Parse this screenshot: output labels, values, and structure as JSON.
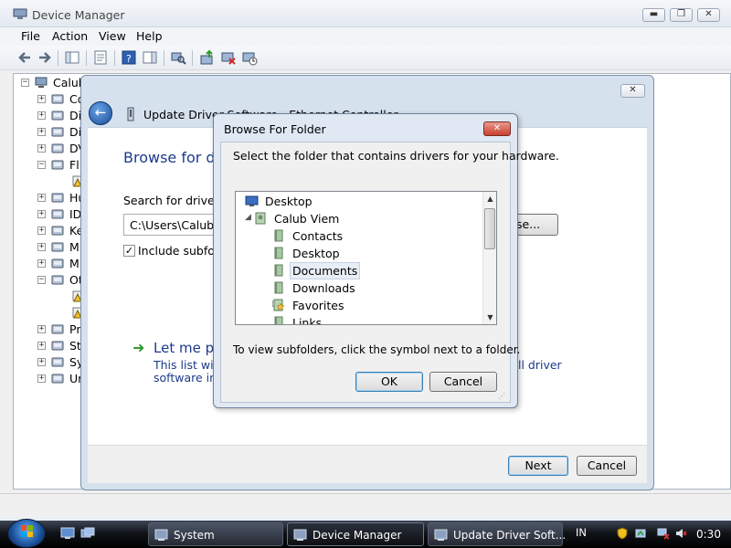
{
  "device_manager": {
    "title": "Device Manager",
    "menu": [
      "File",
      "Action",
      "View",
      "Help"
    ],
    "caption_buttons": {
      "minimize": "▬",
      "maximize": "❐",
      "close": "✕"
    },
    "tree": {
      "root": "Calub",
      "items": [
        {
          "label": "Co",
          "icon": "computer-icon",
          "expander": "+"
        },
        {
          "label": "Di",
          "icon": "disk-drive-icon",
          "expander": "+"
        },
        {
          "label": "Di",
          "icon": "display-adapter-icon",
          "expander": "+"
        },
        {
          "label": "DV",
          "icon": "dvd-drive-icon",
          "expander": "+"
        },
        {
          "label": "Fl",
          "icon": "floppy-controller-icon",
          "expander": "−"
        },
        {
          "label": "",
          "icon": "warning-device-icon",
          "expander": ""
        },
        {
          "label": "Hu",
          "icon": "hid-icon",
          "expander": "+"
        },
        {
          "label": "ID",
          "icon": "ide-controller-icon",
          "expander": "+"
        },
        {
          "label": "Ke",
          "icon": "keyboard-icon",
          "expander": "+"
        },
        {
          "label": "M",
          "icon": "mouse-icon",
          "expander": "+"
        },
        {
          "label": "M",
          "icon": "monitor-icon",
          "expander": "+"
        },
        {
          "label": "Ot",
          "icon": "other-devices-icon",
          "expander": "−"
        },
        {
          "label": "",
          "icon": "warning-device-icon",
          "expander": ""
        },
        {
          "label": "",
          "icon": "warning-device-icon",
          "expander": ""
        },
        {
          "label": "Pr",
          "icon": "processor-icon",
          "expander": "+"
        },
        {
          "label": "St",
          "icon": "storage-icon",
          "expander": "+"
        },
        {
          "label": "Sy",
          "icon": "system-device-icon",
          "expander": "+"
        },
        {
          "label": "Ur",
          "icon": "usb-icon",
          "expander": "+"
        }
      ]
    }
  },
  "update_driver": {
    "title": "Update Driver Software - Ethernet Controller",
    "close_glyph": "✕",
    "heading": "Browse for dri",
    "search_label": "Search for driver so",
    "path_value": "C:\\Users\\Calub Vi",
    "browse_label": "wse...",
    "include_subfolders_label": "Include subfold",
    "include_subfolders_checked": true,
    "option_title": "Let me pic",
    "option_desc_line1": "This list will s",
    "option_desc_line2": "software in t",
    "option_desc_tail": "ll driver",
    "next_label": "Next",
    "cancel_label": "Cancel"
  },
  "browse_folder": {
    "title": "Browse For Folder",
    "close_glyph": "✕",
    "instruction": "Select the folder that contains drivers for your hardware.",
    "tree": [
      {
        "label": "Desktop",
        "icon": "desktop-icon",
        "toggle": "",
        "selected": false
      },
      {
        "label": "Calub Viem",
        "icon": "user-folder-icon",
        "toggle": "◢",
        "selected": false
      },
      {
        "label": "Contacts",
        "icon": "contacts-folder-icon",
        "toggle": "",
        "selected": false
      },
      {
        "label": "Desktop",
        "icon": "desktop-folder-icon",
        "toggle": "",
        "selected": false
      },
      {
        "label": "Documents",
        "icon": "documents-folder-icon",
        "toggle": "",
        "selected": true
      },
      {
        "label": "Downloads",
        "icon": "downloads-folder-icon",
        "toggle": "",
        "selected": false
      },
      {
        "label": "Favorites",
        "icon": "favorites-folder-icon",
        "toggle": "▷",
        "selected": false
      },
      {
        "label": "Links",
        "icon": "links-folder-icon",
        "toggle": "",
        "selected": false
      }
    ],
    "hint": "To view subfolders, click the symbol next to a folder.",
    "ok_label": "OK",
    "cancel_label": "Cancel"
  },
  "taskbar": {
    "tasks": [
      {
        "label": "System",
        "icon": "system-icon",
        "active": false
      },
      {
        "label": "Device Manager",
        "icon": "device-manager-icon",
        "active": true
      },
      {
        "label": "Update Driver Soft...",
        "icon": "update-driver-icon",
        "active": false
      }
    ],
    "language": "IN",
    "clock": "0:30"
  },
  "colors": {
    "heading_blue": "#1c3a8a",
    "green_arrow": "#2e9a2e",
    "close_red": "#c9402e",
    "selection": "#e8eef6"
  }
}
